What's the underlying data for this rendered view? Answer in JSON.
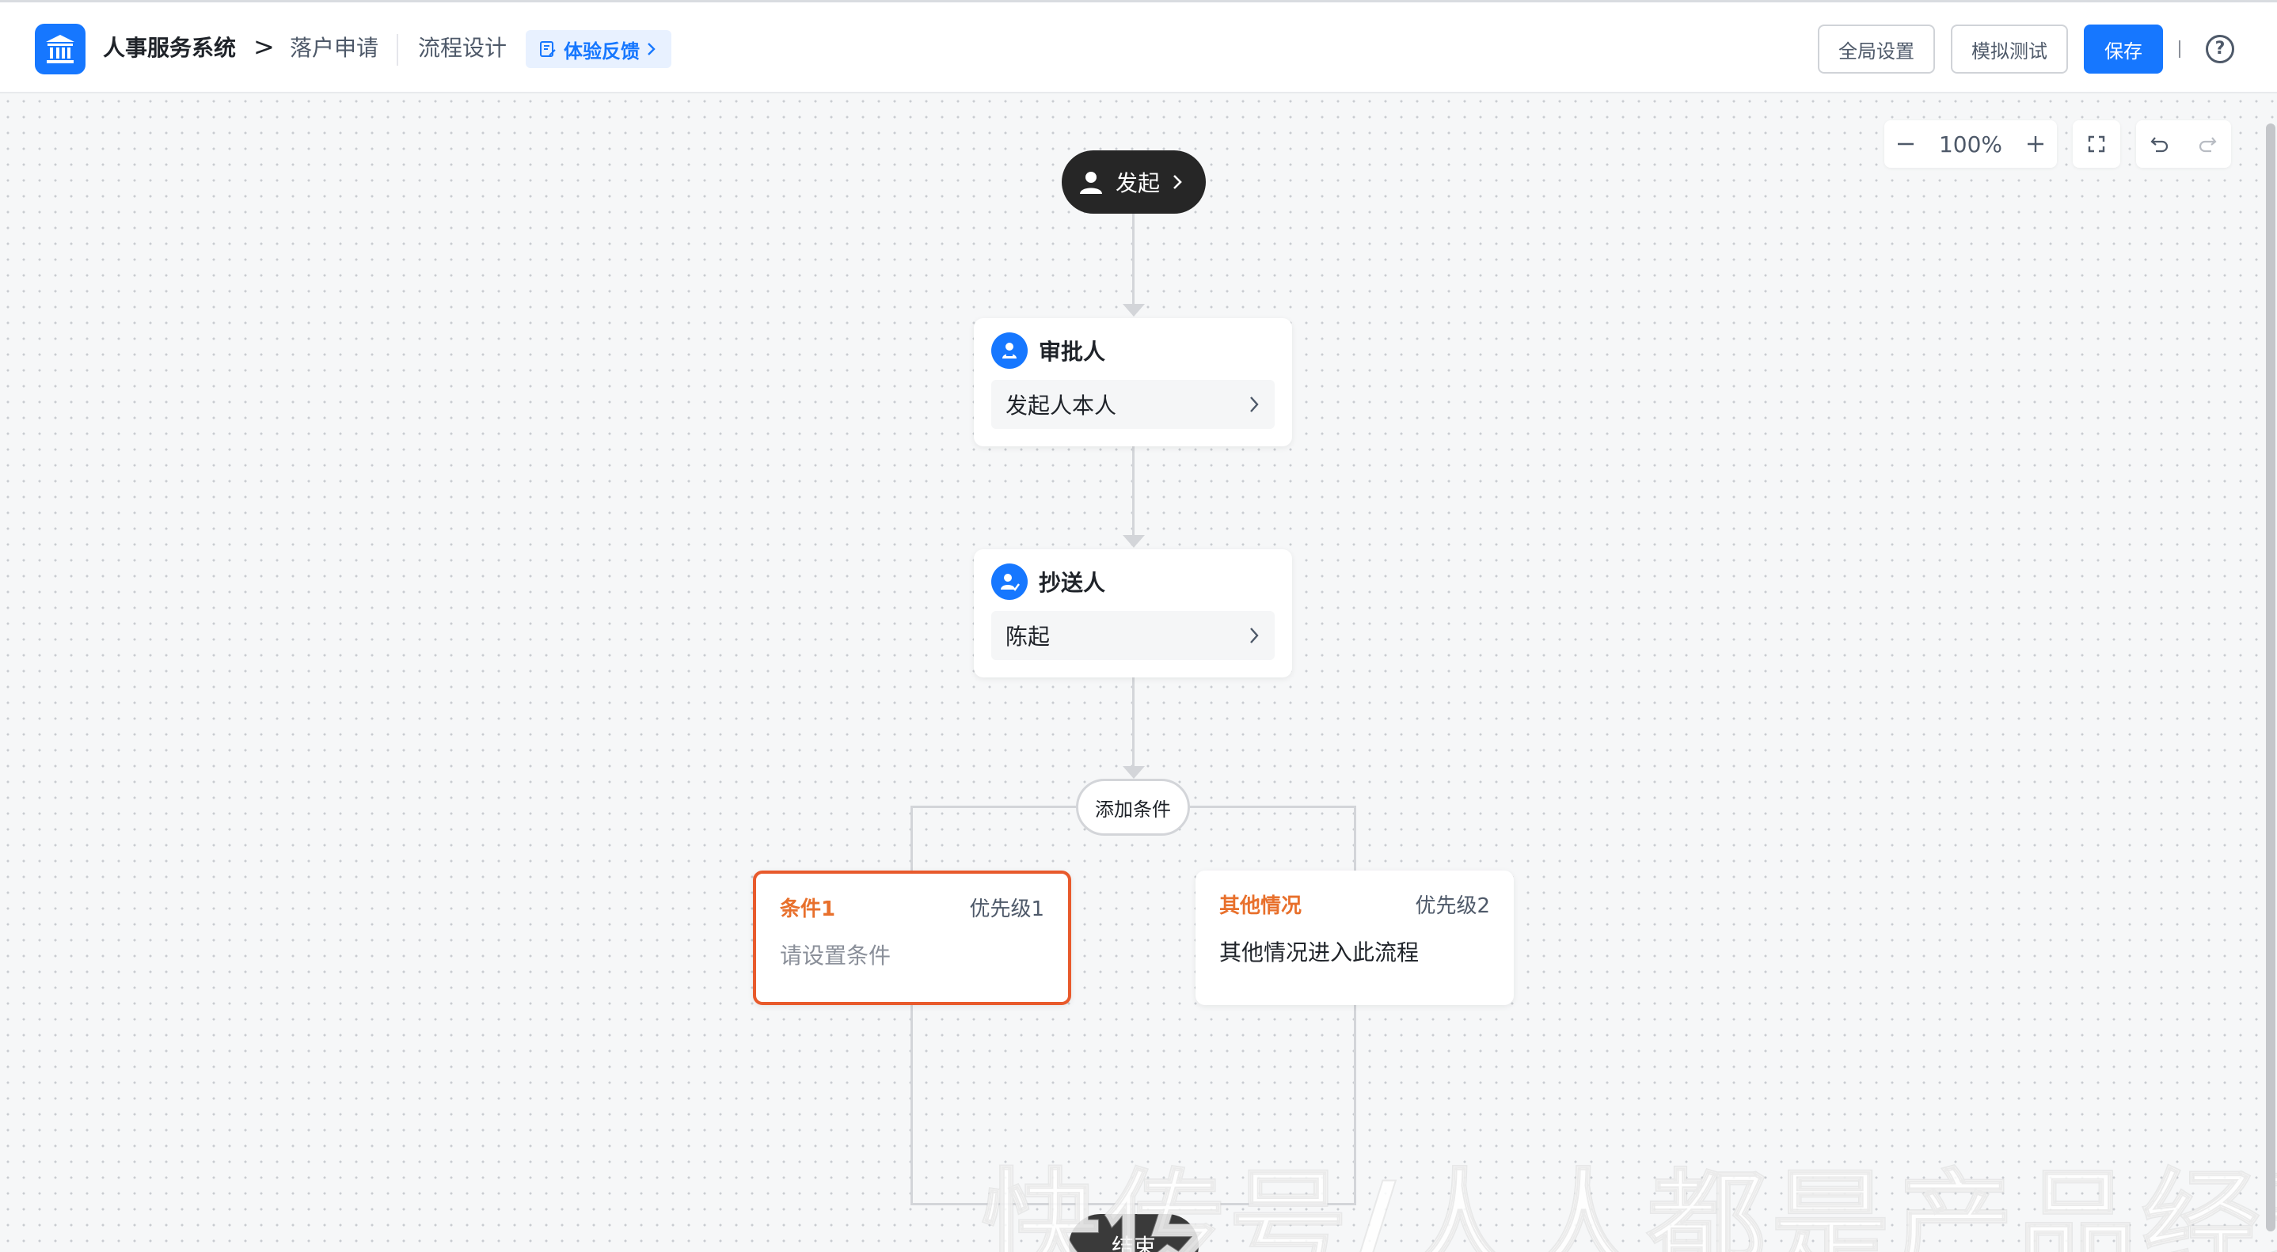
{
  "header": {
    "system_name": "人事服务系统",
    "separator": ">",
    "crumb_apply": "落户申请",
    "crumb_design": "流程设计",
    "feedback_label": "体验反馈",
    "global_settings": "全局设置",
    "simulate_test": "模拟测试",
    "save": "保存",
    "help": "?"
  },
  "toolbar": {
    "zoom_level": "100%"
  },
  "flow": {
    "start": {
      "label": "发起"
    },
    "approver": {
      "title": "审批人",
      "value": "发起人本人"
    },
    "cc": {
      "title": "抄送人",
      "value": "陈起"
    },
    "add_condition": "添加条件",
    "branches": [
      {
        "name": "条件1",
        "priority": "优先级1",
        "desc": "请设置条件"
      },
      {
        "name": "其他情况",
        "priority": "优先级2",
        "desc": "其他情况进入此流程"
      }
    ],
    "end": {
      "label": "结束"
    }
  },
  "watermark": "快传号/人人都是产品经理",
  "colors": {
    "primary": "#1677ff",
    "branch_selected_border": "#e85a2c",
    "branch_name": "#e8702c",
    "start_node": "#262626"
  }
}
